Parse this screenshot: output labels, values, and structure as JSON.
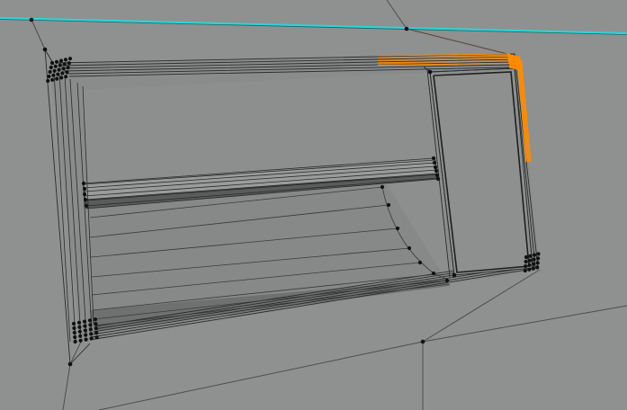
{
  "viewport": {
    "mode": "edit-mesh",
    "background_color": "#8f9090",
    "wire_color": "#2a2b2b",
    "edge_color_dark": "#3a3b3b",
    "vertex_color": "#111111",
    "selected_color": "#ff8c00",
    "seam_color": "#2ed3d6"
  }
}
